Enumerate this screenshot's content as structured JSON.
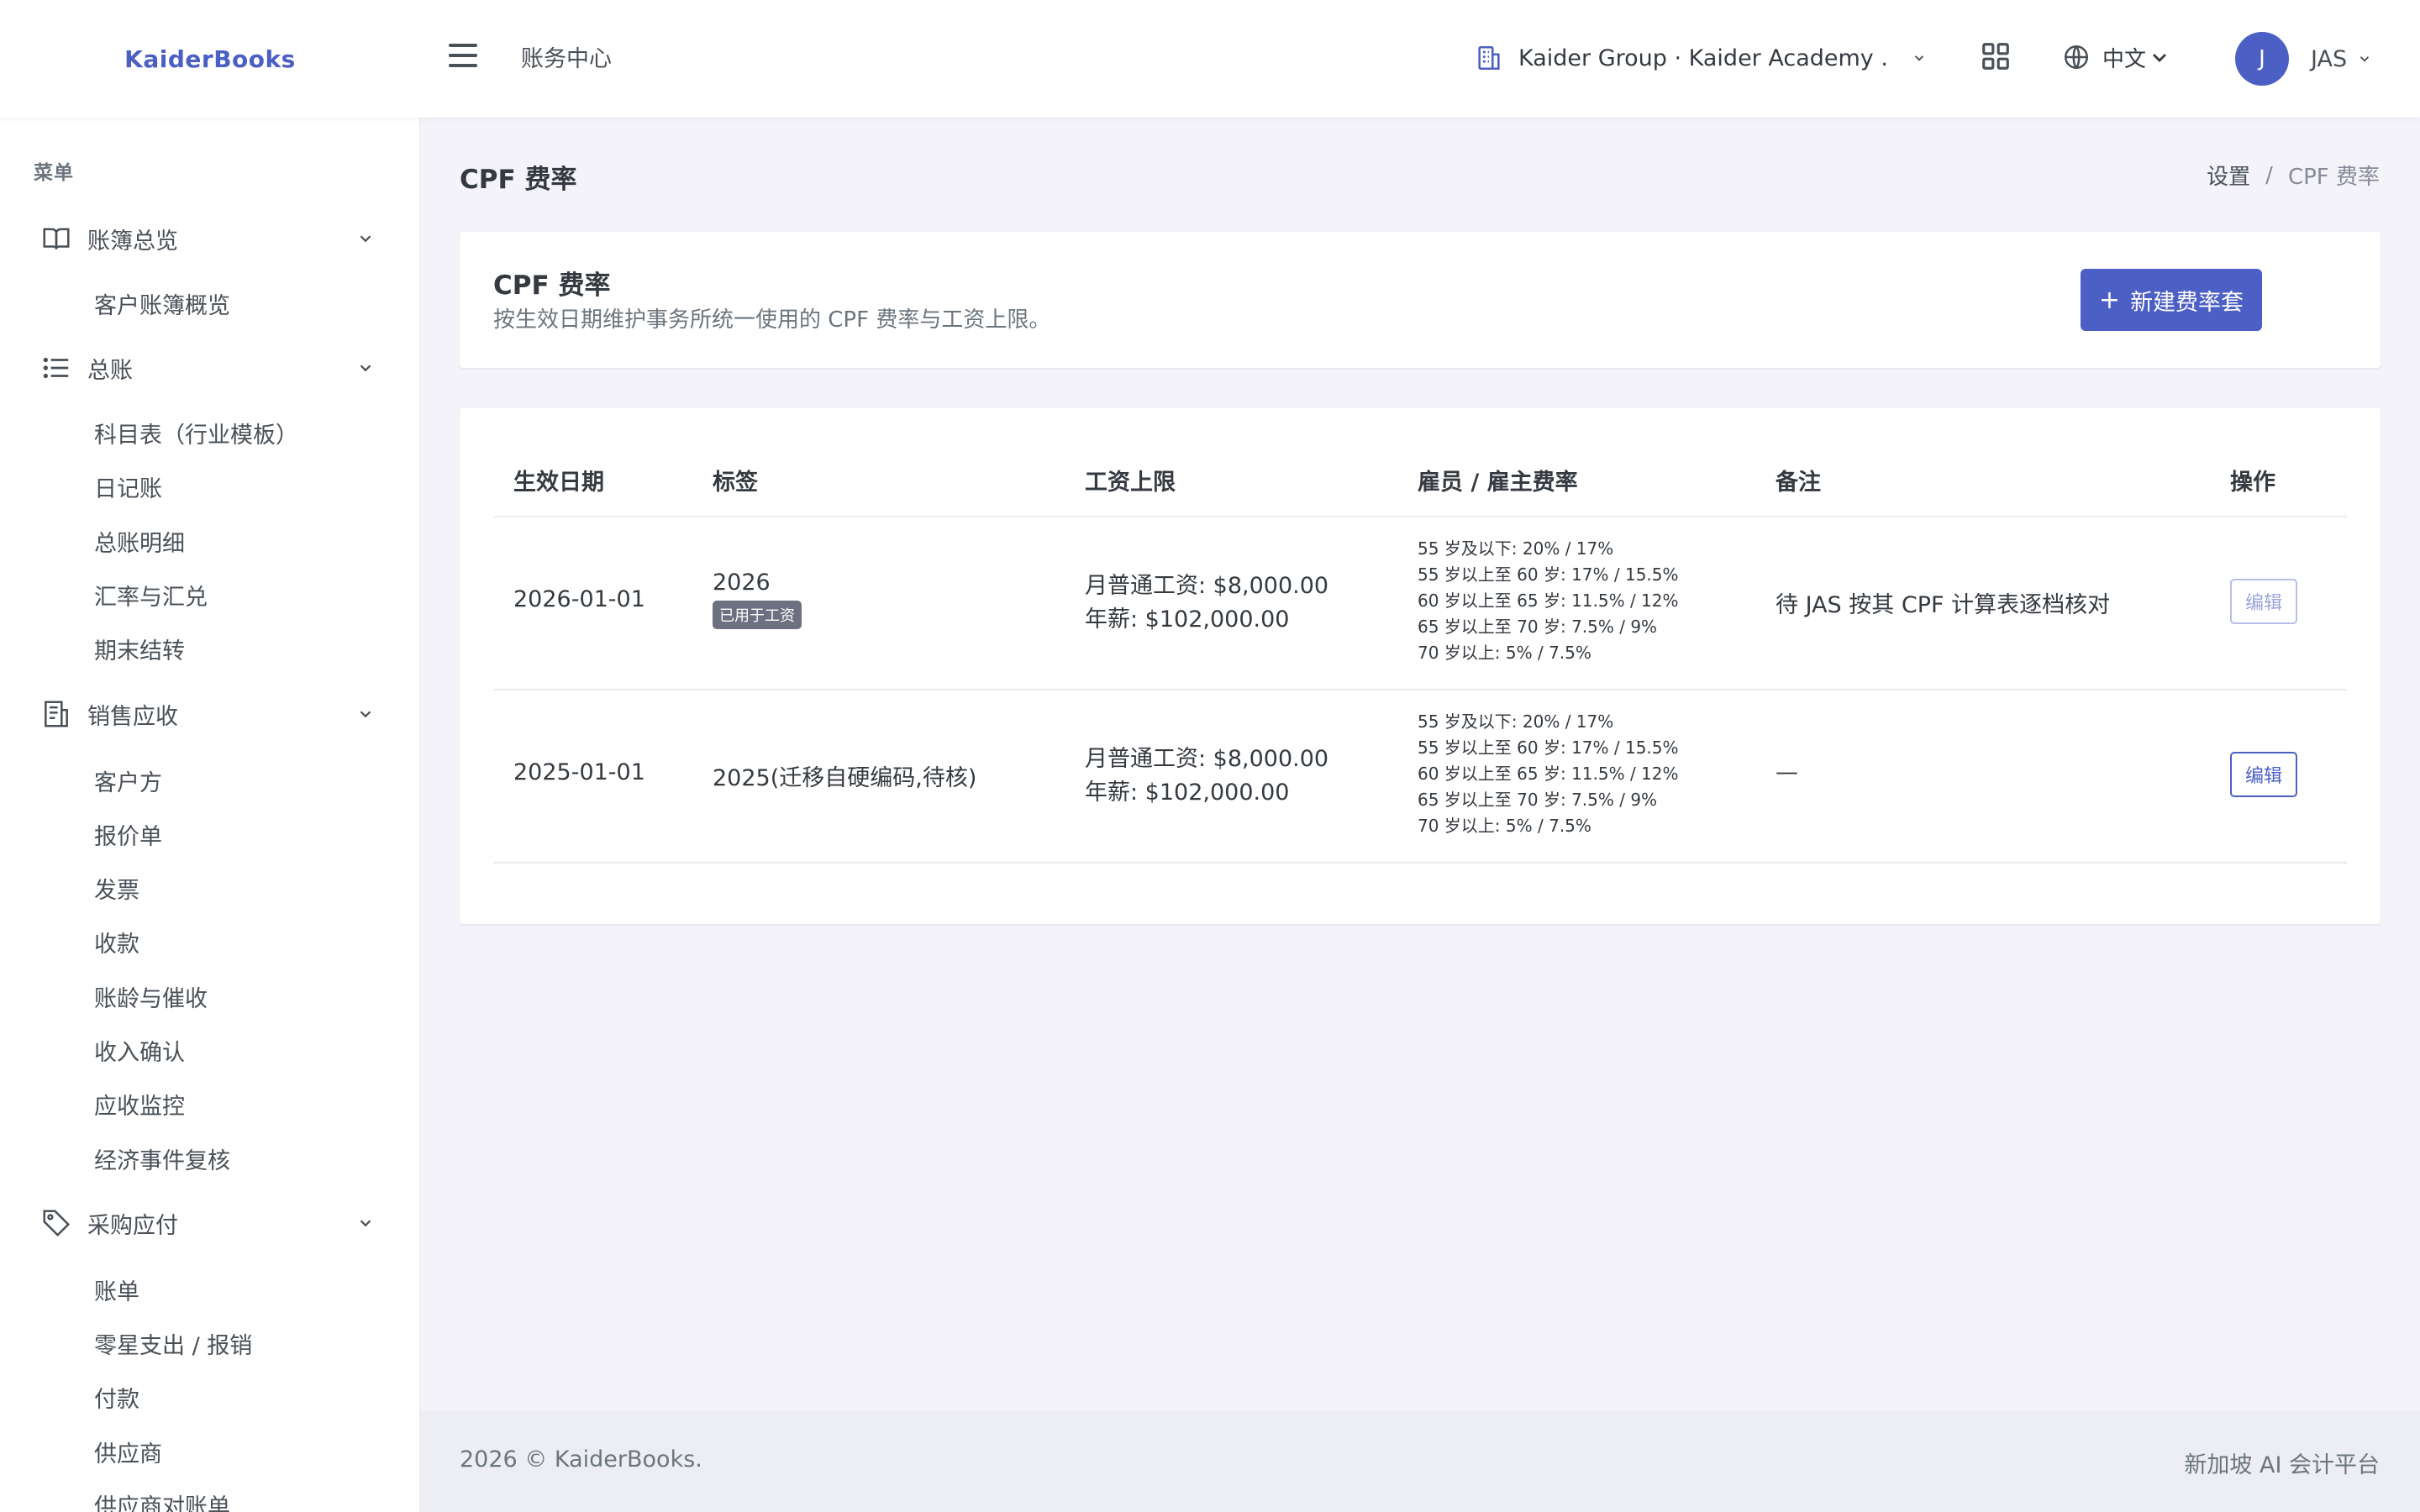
{
  "app": {
    "name": "KaiderBooks"
  },
  "header": {
    "title": "账务中心",
    "org": "Kaider Group · Kaider Academy ...",
    "language": "中文",
    "user": {
      "initial": "J",
      "name": "JAS"
    }
  },
  "sidebar": {
    "menu_title": "菜单",
    "groups": [
      {
        "label": "账簿总览",
        "icon": "book-icon",
        "items": [
          "客户账簿概览"
        ]
      },
      {
        "label": "总账",
        "icon": "list-icon",
        "items": [
          "科目表（行业模板）",
          "日记账",
          "总账明细",
          "汇率与汇兑",
          "期末结转"
        ]
      },
      {
        "label": "销售应收",
        "icon": "receipt-icon",
        "items": [
          "客户方",
          "报价单",
          "发票",
          "收款",
          "账龄与催收",
          "收入确认",
          "应收监控",
          "经济事件复核"
        ]
      },
      {
        "label": "采购应付",
        "icon": "tag-icon",
        "items": [
          "账单",
          "零星支出 / 报销",
          "付款",
          "供应商",
          "供应商对账单"
        ]
      }
    ]
  },
  "page": {
    "title": "CPF 费率",
    "breadcrumb": [
      "设置",
      "CPF 费率"
    ]
  },
  "intro": {
    "title": "CPF 费率",
    "subtitle": "按生效日期维护事务所统一使用的 CPF 费率与工资上限。",
    "new_button": "新建费率套"
  },
  "table": {
    "headers": [
      "生效日期",
      "标签",
      "工资上限",
      "雇员 / 雇主费率",
      "备注",
      "操作"
    ],
    "rows": [
      {
        "date": "2026-01-01",
        "label": "2026",
        "badge": "已用于工资",
        "cap_monthly": "月普通工资: $8,000.00",
        "cap_annual": "年薪: $102,000.00",
        "rates": [
          "55 岁及以下: 20% / 17%",
          "55 岁以上至 60 岁: 17% / 15.5%",
          "60 岁以上至 65 岁: 11.5% / 12%",
          "65 岁以上至 70 岁: 7.5% / 9%",
          "70 岁以上: 5% / 7.5%"
        ],
        "note": "待 JAS 按其 CPF 计算表逐档核对",
        "action": "编辑"
      },
      {
        "date": "2025-01-01",
        "label": "2025(迁移自硬编码,待核)",
        "badge": "",
        "cap_monthly": "月普通工资: $8,000.00",
        "cap_annual": "年薪: $102,000.00",
        "rates": [
          "55 岁及以下: 20% / 17%",
          "55 岁以上至 60 岁: 17% / 15.5%",
          "60 岁以上至 65 岁: 11.5% / 12%",
          "65 岁以上至 70 岁: 7.5% / 9%",
          "70 岁以上: 5% / 7.5%"
        ],
        "note": "—",
        "action": "编辑"
      }
    ]
  },
  "footer": {
    "left": "2026 © KaiderBooks.",
    "right": "新加坡 AI 会计平台"
  },
  "colors": {
    "primary": "#4b5fc4",
    "background": "#f3f3f9",
    "badge": "#6d7080"
  }
}
